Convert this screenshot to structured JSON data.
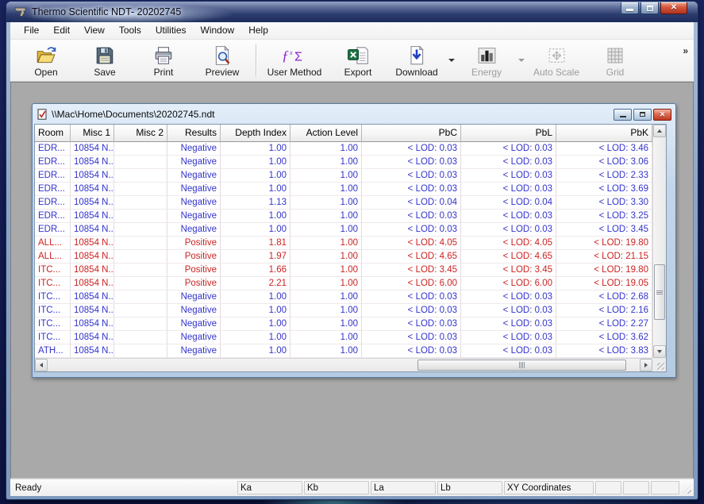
{
  "window": {
    "title": "Thermo Scientific NDT- 20202745"
  },
  "menu": {
    "items": [
      "File",
      "Edit",
      "View",
      "Tools",
      "Utilities",
      "Window",
      "Help"
    ]
  },
  "toolbar": {
    "buttons": [
      {
        "label": "Open",
        "icon": "folder-open",
        "enabled": true
      },
      {
        "label": "Save",
        "icon": "save",
        "enabled": true
      },
      {
        "label": "Print",
        "icon": "print",
        "enabled": true
      },
      {
        "label": "Preview",
        "icon": "preview",
        "enabled": true
      },
      {
        "type": "separator"
      },
      {
        "label": "User Method",
        "icon": "user-method",
        "enabled": true,
        "wide": true
      },
      {
        "label": "Export",
        "icon": "export",
        "enabled": true
      },
      {
        "label": "Download",
        "icon": "download",
        "enabled": true,
        "dropdown": true
      },
      {
        "label": "Energy",
        "icon": "energy",
        "enabled": false,
        "dropdown": true
      },
      {
        "label": "Auto Scale",
        "icon": "auto-scale",
        "enabled": false
      },
      {
        "label": "Grid",
        "icon": "grid",
        "enabled": false
      }
    ],
    "overflow_chevron": "»"
  },
  "child_window": {
    "title": "\\\\Mac\\Home\\Documents\\20202745.ndt",
    "table": {
      "columns": [
        "Room",
        "Misc 1",
        "Misc 2",
        "Results",
        "Depth Index",
        "Action Level",
        "PbC",
        "PbL",
        "PbK"
      ],
      "rows": [
        {
          "status": "negative",
          "cells": [
            "EDR...",
            "10854 N...",
            "",
            "Negative",
            "1.00",
            "1.00",
            "< LOD: 0.03",
            "< LOD: 0.03",
            "< LOD: 3.46"
          ]
        },
        {
          "status": "negative",
          "cells": [
            "EDR...",
            "10854 N...",
            "",
            "Negative",
            "1.00",
            "1.00",
            "< LOD: 0.03",
            "< LOD: 0.03",
            "< LOD: 3.06"
          ]
        },
        {
          "status": "negative",
          "cells": [
            "EDR...",
            "10854 N...",
            "",
            "Negative",
            "1.00",
            "1.00",
            "< LOD: 0.03",
            "< LOD: 0.03",
            "< LOD: 2.33"
          ]
        },
        {
          "status": "negative",
          "cells": [
            "EDR...",
            "10854 N...",
            "",
            "Negative",
            "1.00",
            "1.00",
            "< LOD: 0.03",
            "< LOD: 0.03",
            "< LOD: 3.69"
          ]
        },
        {
          "status": "negative",
          "cells": [
            "EDR...",
            "10854 N...",
            "",
            "Negative",
            "1.13",
            "1.00",
            "< LOD: 0.04",
            "< LOD: 0.04",
            "< LOD: 3.30"
          ]
        },
        {
          "status": "negative",
          "cells": [
            "EDR...",
            "10854 N...",
            "",
            "Negative",
            "1.00",
            "1.00",
            "< LOD: 0.03",
            "< LOD: 0.03",
            "< LOD: 3.25"
          ]
        },
        {
          "status": "negative",
          "cells": [
            "EDR...",
            "10854 N...",
            "",
            "Negative",
            "1.00",
            "1.00",
            "< LOD: 0.03",
            "< LOD: 0.03",
            "< LOD: 3.45"
          ]
        },
        {
          "status": "positive",
          "cells": [
            "ALL...",
            "10854 N...",
            "",
            "Positive",
            "1.81",
            "1.00",
            "< LOD: 4.05",
            "< LOD: 4.05",
            "< LOD: 19.80"
          ]
        },
        {
          "status": "positive",
          "cells": [
            "ALL...",
            "10854 N...",
            "",
            "Positive",
            "1.97",
            "1.00",
            "< LOD: 4.65",
            "< LOD: 4.65",
            "< LOD: 21.15"
          ]
        },
        {
          "status": "positive",
          "cells": [
            "ITC...",
            "10854 N...",
            "",
            "Positive",
            "1.66",
            "1.00",
            "< LOD: 3.45",
            "< LOD: 3.45",
            "< LOD: 19.80"
          ]
        },
        {
          "status": "positive",
          "cells": [
            "ITC...",
            "10854 N...",
            "",
            "Positive",
            "2.21",
            "1.00",
            "< LOD: 6.00",
            "< LOD: 6.00",
            "< LOD: 19.05"
          ]
        },
        {
          "status": "negative",
          "cells": [
            "ITC...",
            "10854 N...",
            "",
            "Negative",
            "1.00",
            "1.00",
            "< LOD: 0.03",
            "< LOD: 0.03",
            "< LOD: 2.68"
          ]
        },
        {
          "status": "negative",
          "cells": [
            "ITC...",
            "10854 N...",
            "",
            "Negative",
            "1.00",
            "1.00",
            "< LOD: 0.03",
            "< LOD: 0.03",
            "< LOD: 2.16"
          ]
        },
        {
          "status": "negative",
          "cells": [
            "ITC...",
            "10854 N...",
            "",
            "Negative",
            "1.00",
            "1.00",
            "< LOD: 0.03",
            "< LOD: 0.03",
            "< LOD: 2.27"
          ]
        },
        {
          "status": "negative",
          "cells": [
            "ITC...",
            "10854 N...",
            "",
            "Negative",
            "1.00",
            "1.00",
            "< LOD: 0.03",
            "< LOD: 0.03",
            "< LOD: 3.62"
          ]
        },
        {
          "status": "negative",
          "cells": [
            "ATH...",
            "10854 N...",
            "",
            "Negative",
            "1.00",
            "1.00",
            "< LOD: 0.03",
            "< LOD: 0.03",
            "< LOD: 3.83"
          ]
        }
      ]
    }
  },
  "status_bar": {
    "ready": "Ready",
    "cells": [
      "Ka",
      "Kb",
      "La",
      "Lb",
      "XY Coordinates",
      "",
      "",
      ""
    ]
  },
  "colors": {
    "negative": "#3333CC",
    "positive": "#CC2222"
  }
}
